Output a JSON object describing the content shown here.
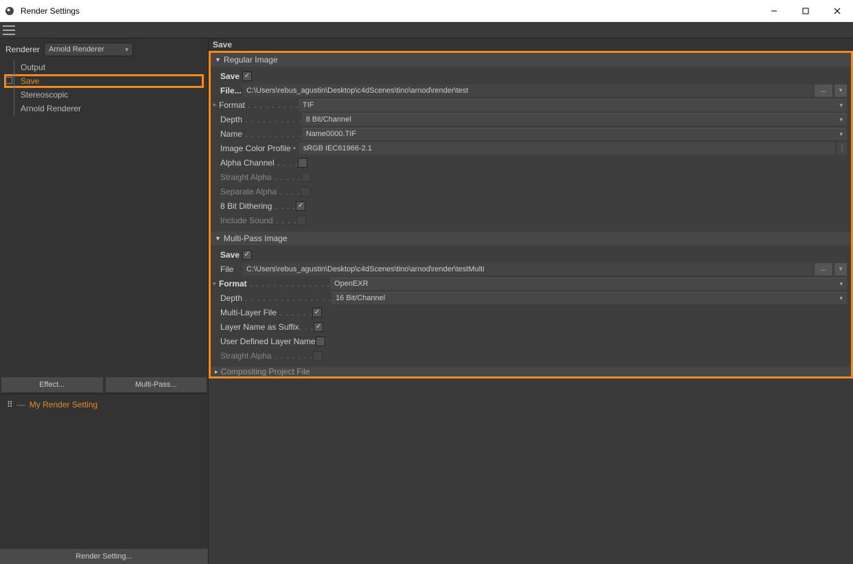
{
  "window": {
    "title": "Render Settings"
  },
  "sidebar": {
    "renderer_label": "Renderer",
    "renderer_value": "Arnold Renderer",
    "items": [
      "Output",
      "Save",
      "Stereoscopic",
      "Arnold Renderer"
    ],
    "active_index": 1,
    "effect_btn": "Effect...",
    "multipass_btn": "Multi-Pass...",
    "my_setting": "My Render Setting",
    "render_setting_btn": "Render Setting..."
  },
  "content": {
    "title": "Save",
    "regular": {
      "header": "Regular Image",
      "save_label": "Save",
      "save_checked": true,
      "file_label": "File...",
      "file_value": "C:\\Users\\rebus_agustin\\Desktop\\c4dScenes\\tino\\arnod\\render\\test",
      "format_label": "Format",
      "format_value": "TIF",
      "depth_label": "Depth",
      "depth_value": "8 Bit/Channel",
      "name_label": "Name",
      "name_value": "Name0000.TIF",
      "color_profile_label": "Image Color Profile",
      "color_profile_value": "sRGB IEC61966-2.1",
      "alpha_label": "Alpha Channel",
      "alpha_checked": false,
      "straight_alpha_label": "Straight Alpha",
      "separate_alpha_label": "Separate Alpha",
      "dither_label": "8 Bit Dithering",
      "dither_checked": true,
      "include_sound_label": "Include Sound"
    },
    "multipass": {
      "header": "Multi-Pass Image",
      "save_label": "Save",
      "save_checked": true,
      "file_label": "File",
      "file_value": "C:\\Users\\rebus_agustin\\Desktop\\c4dScenes\\tino\\arnod\\render\\testMulti",
      "format_label": "Format",
      "format_value": "OpenEXR",
      "depth_label": "Depth",
      "depth_value": "16 Bit/Channel",
      "multilayer_label": "Multi-Layer File",
      "multilayer_checked": true,
      "layer_suffix_label": "Layer Name as Suffix",
      "layer_suffix_checked": true,
      "user_layer_label": "User Defined Layer Name",
      "user_layer_checked": false,
      "straight_alpha_label": "Straight Alpha"
    },
    "compositing_header": "Compositing Project File"
  }
}
